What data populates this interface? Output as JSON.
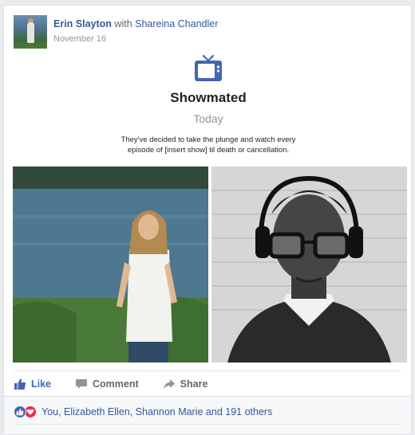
{
  "post": {
    "author": "Erin Slayton",
    "with_word": "with",
    "tagged": "Shareina Chandler",
    "date": "November 16"
  },
  "activity": {
    "icon": "tv-icon",
    "title": "Showmated",
    "subtitle": "Today",
    "description": "They've decided to take the plunge and watch every episode of [insert show] til death or cancellation."
  },
  "actions": {
    "like": "Like",
    "comment": "Comment",
    "share": "Share"
  },
  "reactions": {
    "summary": "You, Elizabeth Ellen, Shannon Marie and 191 others"
  },
  "colors": {
    "link": "#365899",
    "like_blue": "#4267b2",
    "love_red": "#f0284a",
    "tv_blue": "#4267b2"
  }
}
